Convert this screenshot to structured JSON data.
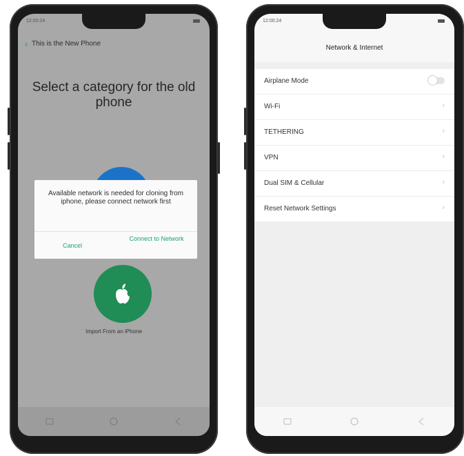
{
  "phone1": {
    "status_time": "12:00:24",
    "back_label": "This is the New Phone",
    "headline": "Select a category for the old phone",
    "dialog": {
      "message": "Available network is needed for cloning from iphone, please connect network first",
      "cancel": "Cancel",
      "connect": "Connect to Network"
    },
    "import_label": "Import From an iPhone"
  },
  "phone2": {
    "status_time": "12:00:24",
    "title": "Network & Internet",
    "items": [
      {
        "label": "Airplane Mode",
        "control": "toggle",
        "checked": false
      },
      {
        "label": "Wi-Fi",
        "control": "chevron"
      },
      {
        "label": "TETHERING",
        "control": "chevron"
      },
      {
        "label": "VPN",
        "control": "chevron"
      },
      {
        "label": "Dual SIM & Cellular",
        "control": "chevron"
      },
      {
        "label": "Reset Network Settings",
        "control": "chevron"
      }
    ]
  },
  "colors": {
    "accent_green": "#1aa569",
    "apple_circle": "#1f8d55",
    "blue_circle": "#1b73c8"
  },
  "icons": {
    "back": "chevron-left-icon",
    "apple": "apple-icon",
    "nav": [
      "menu-icon",
      "home-icon",
      "back-triangle-icon"
    ],
    "row": "chevron-right-icon"
  }
}
